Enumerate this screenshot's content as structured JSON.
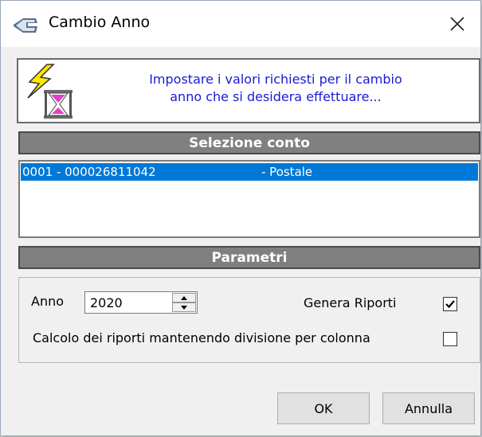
{
  "window": {
    "title": "Cambio Anno",
    "close_label": "✕"
  },
  "info": {
    "message_line1": "Impostare i valori richiesti per il cambio",
    "message_line2": "anno che si desidera effettuare...",
    "icon": "lightning-hourglass-icon"
  },
  "account_section": {
    "header": "Selezione conto",
    "items": [
      {
        "code": "0001 - 000026811042",
        "type": "- Postale",
        "selected": true
      }
    ]
  },
  "params_section": {
    "header": "Parametri",
    "year_label": "Anno",
    "year_value": "2020",
    "genera_riporti_label": "Genera Riporti",
    "genera_riporti_checked": true,
    "calcolo_label": "Calcolo dei riporti mantenendo divisione per colonna",
    "calcolo_checked": false
  },
  "buttons": {
    "ok": "OK",
    "cancel": "Annulla"
  },
  "colors": {
    "selection": "#0078d7",
    "header_bg": "#808080",
    "info_text": "#1a1ad4"
  }
}
